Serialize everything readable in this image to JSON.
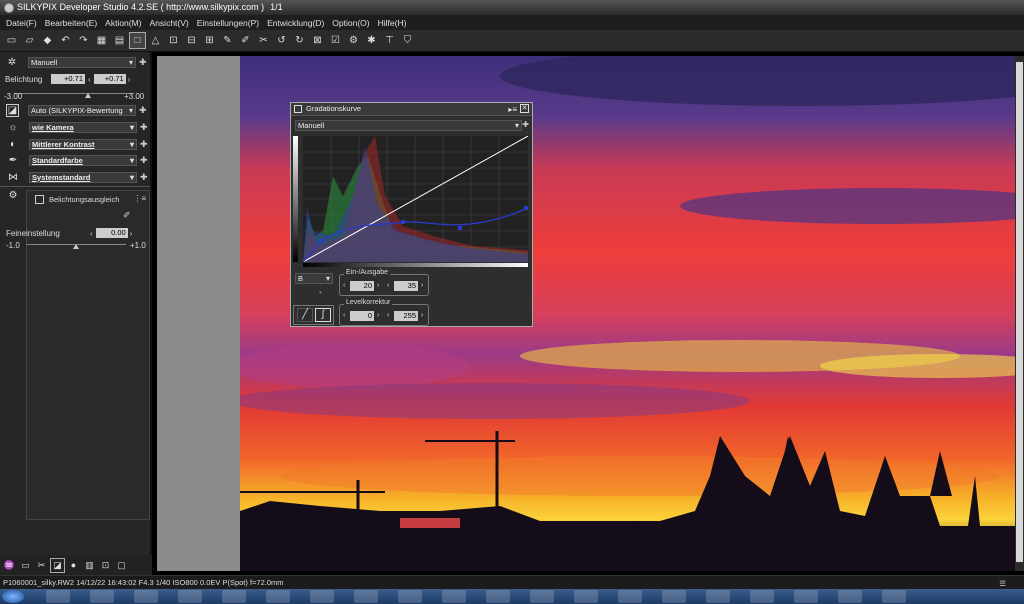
{
  "window": {
    "title": "SILKYPIX Developer Studio 4.2.SE ( http://www.silkypix.com )",
    "counter": "1/1"
  },
  "menu": [
    "Datei(F)",
    "Bearbeiten(E)",
    "Aktion(M)",
    "Ansicht(V)",
    "Einstellungen(P)",
    "Entwicklung(D)",
    "Option(O)",
    "Hilfe(H)"
  ],
  "left_panel": {
    "preset": "Manuell",
    "exposure_label": "Belichtung",
    "exposure_value_1": "+0.71",
    "exposure_value_2": "+0.71",
    "exposure_min": "-3.00",
    "exposure_max": "+3.00",
    "exposure_level": 0.62,
    "exposure_rating": "Auto (SILKYPIX-Bewertung",
    "white_balance": "wie Kamera",
    "contrast": "Mittlerer Kontrast",
    "color": "Standardfarbe",
    "sharpness": "Systemstandard",
    "sub_section": "Belichtungsausgleich",
    "fine_label": "Feineinstellung",
    "fine_value": "0.00",
    "fine_min": "-1.0",
    "fine_max": "+1.0",
    "fine_level": 0.5
  },
  "curve_dialog": {
    "title": "Gradationskurve",
    "mode": "Manuell",
    "channel": "B",
    "in_out_label": "Ein-/Ausgabe",
    "in_value": "20",
    "out_value": "35",
    "level_label": "Levelkorrektur",
    "level_min": "0",
    "level_max": "255"
  },
  "status": {
    "text": "P1060001_silky.RW2 14/12/22 16:43:02 F4.3 1/40 ISO800  0.0EV P(Spot) f=72.0mm"
  },
  "colors": {
    "panel": "#262626",
    "sky_red": "#e8322e",
    "sky_yellow": "#f4d12a",
    "sky_purple": "#4b3f8c"
  }
}
